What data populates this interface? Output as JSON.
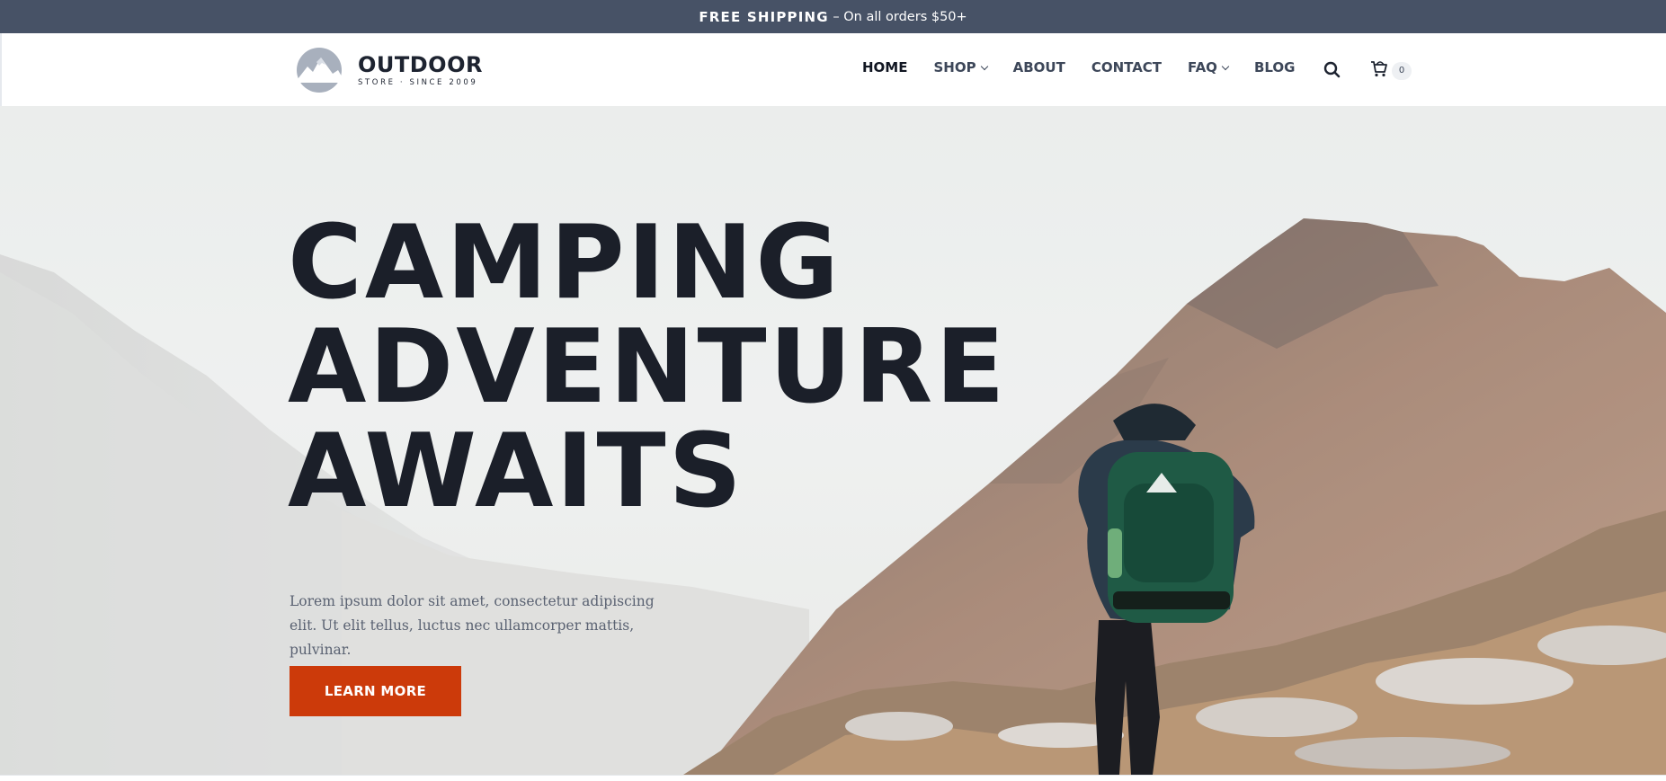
{
  "topbar": {
    "strong": "FREE SHIPPING",
    "rest": " – On all orders $50+"
  },
  "header": {
    "logo": {
      "name": "OUTDOOR",
      "tagline": "STORE · SINCE 2009",
      "icon": "mountain-logo-icon"
    },
    "nav": [
      {
        "label": "HOME",
        "active": true,
        "dropdown": false
      },
      {
        "label": "SHOP",
        "active": false,
        "dropdown": true
      },
      {
        "label": "ABOUT",
        "active": false,
        "dropdown": false
      },
      {
        "label": "CONTACT",
        "active": false,
        "dropdown": false
      },
      {
        "label": "FAQ",
        "active": false,
        "dropdown": true
      },
      {
        "label": "BLOG",
        "active": false,
        "dropdown": false
      }
    ],
    "search_icon": "search-icon",
    "cart_icon": "shopping-cart-icon",
    "cart_count": "0"
  },
  "hero": {
    "title_lines": [
      "CAMPING",
      "ADVENTURE",
      "AWAITS"
    ],
    "description": "Lorem ipsum dolor sit amet, consectetur adipiscing elit. Ut elit tellus, luctus nec ullamcorper mattis, pulvinar.",
    "cta_label": "LEARN MORE"
  },
  "colors": {
    "topbar": "#475266",
    "cta": "#cc3a0a",
    "heading": "#1b1f29",
    "mountain": "#8a6a58",
    "backpack": "#1f5a45"
  }
}
